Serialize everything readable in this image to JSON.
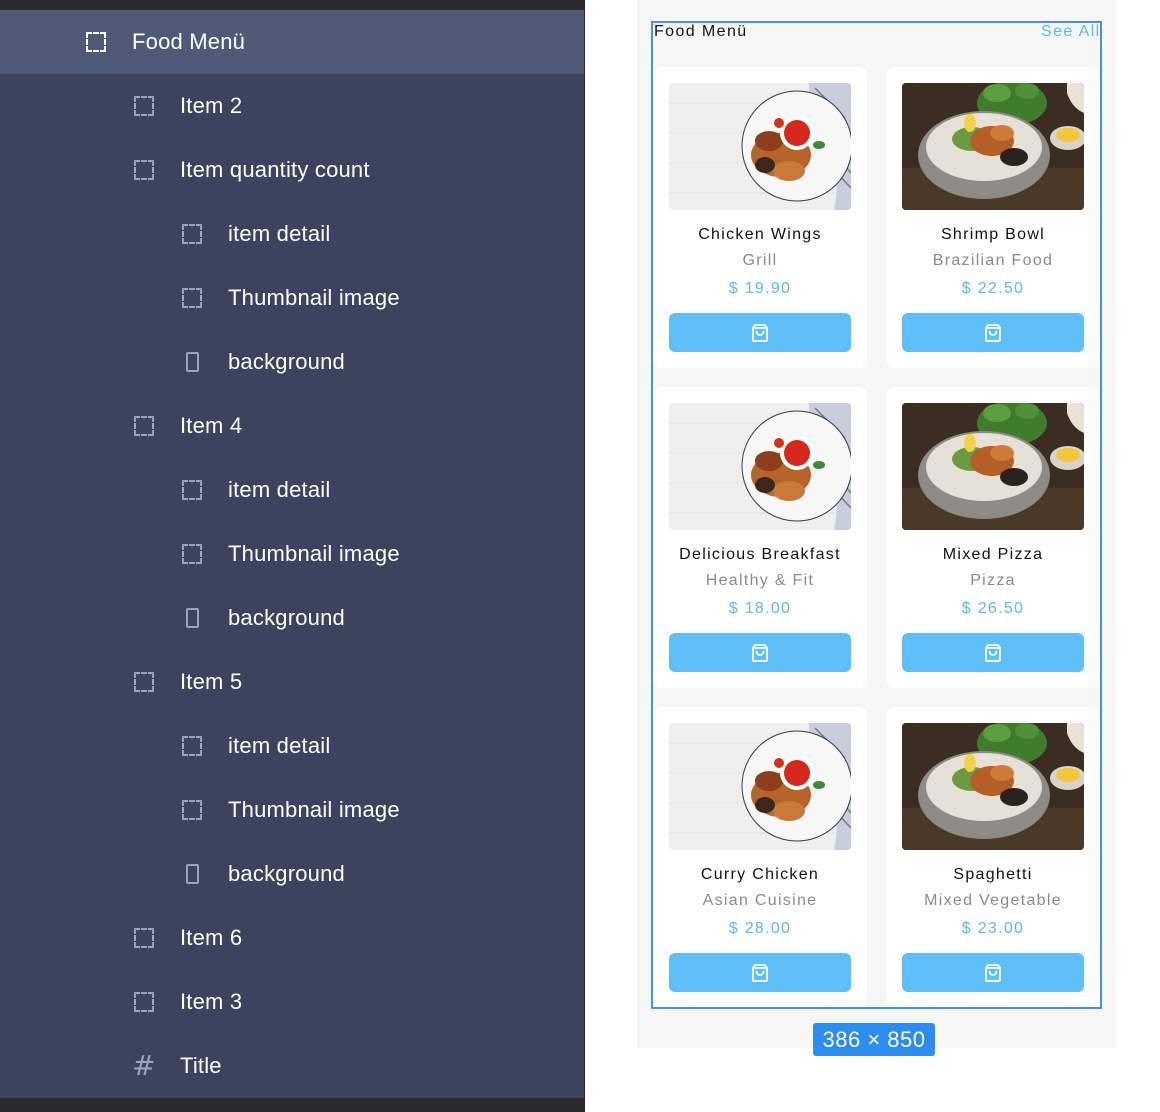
{
  "layers": [
    {
      "label": "Food Menü",
      "icon": "frame-dashed-icon",
      "selected": true
    },
    {
      "label": "Item 2",
      "icon": "frame-dashed-icon"
    },
    {
      "label": "Item quantity count",
      "icon": "frame-dashed-icon"
    },
    {
      "label": "item detail",
      "icon": "frame-dashed-icon"
    },
    {
      "label": "Thumbnail image",
      "icon": "frame-dashed-icon"
    },
    {
      "label": "background",
      "icon": "rectangle-icon"
    },
    {
      "label": "Item 4",
      "icon": "frame-dashed-icon"
    },
    {
      "label": "item detail",
      "icon": "frame-dashed-icon"
    },
    {
      "label": "Thumbnail image",
      "icon": "frame-dashed-icon"
    },
    {
      "label": "background",
      "icon": "rectangle-icon"
    },
    {
      "label": "Item 5",
      "icon": "frame-dashed-icon"
    },
    {
      "label": "item detail",
      "icon": "frame-dashed-icon"
    },
    {
      "label": "Thumbnail image",
      "icon": "frame-dashed-icon"
    },
    {
      "label": "background",
      "icon": "rectangle-icon"
    },
    {
      "label": "Item 6",
      "icon": "frame-dashed-icon"
    },
    {
      "label": "Item 3",
      "icon": "frame-dashed-icon"
    },
    {
      "label": "Title",
      "icon": "hash-frame-icon"
    }
  ],
  "menu": {
    "title": "Food Menü",
    "see_all": "See All"
  },
  "items": [
    {
      "name": "Chicken Wings",
      "category": "Grill",
      "price": "$ 19.90",
      "image": "chicken-wings-image"
    },
    {
      "name": "Shrimp Bowl",
      "category": "Brazilian Food",
      "price": "$ 22.50",
      "image": "shrimp-bowl-image"
    },
    {
      "name": "Delicious Breakfast",
      "category": "Healthy & Fit",
      "price": "$ 18.00",
      "image": "chicken-wings-image"
    },
    {
      "name": "Mixed Pizza",
      "category": "Pizza",
      "price": "$ 26.50",
      "image": "shrimp-bowl-image"
    },
    {
      "name": "Curry Chicken",
      "category": "Asian Cuisine",
      "price": "$ 28.00",
      "image": "chicken-wings-image"
    },
    {
      "name": "Spaghetti",
      "category": "Mixed Vegetable",
      "price": "$ 23.00",
      "image": "shrimp-bowl-image"
    }
  ],
  "selection_size": "386 × 850",
  "colors": {
    "panel": "#3b435e",
    "panel_selected": "#4e5a78",
    "accent": "#5bb8f5",
    "button": "#5fbdf7",
    "selection": "#4a90e2"
  }
}
